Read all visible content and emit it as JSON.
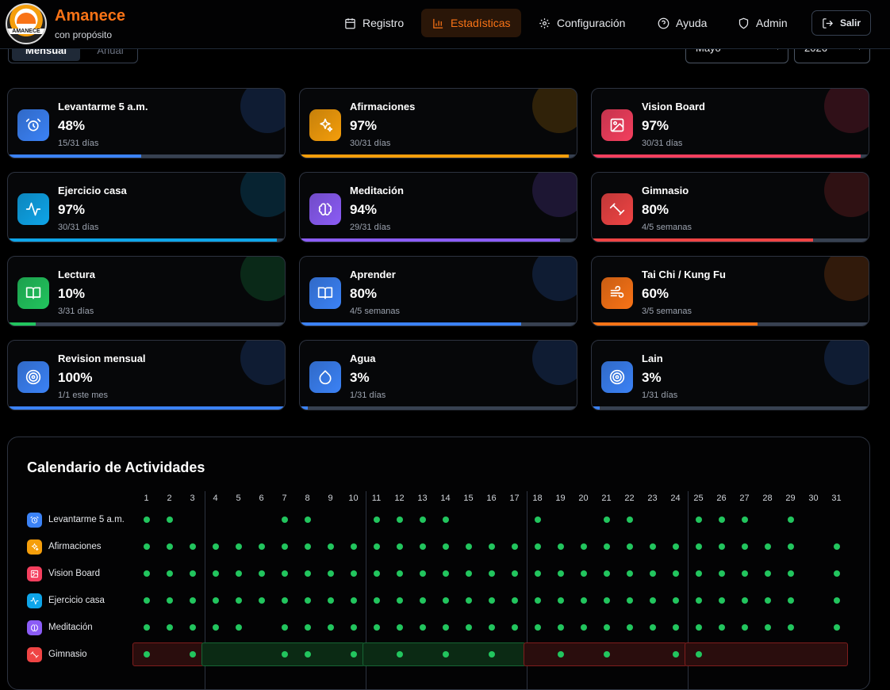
{
  "header": {
    "brand": "Amanece",
    "tagline": "con propósito",
    "logo_text": "AMANECE",
    "nav": [
      {
        "label": "Registro",
        "icon": "calendar-icon"
      },
      {
        "label": "Estadísticas",
        "icon": "bar-chart-icon",
        "active": true
      },
      {
        "label": "Configuración",
        "icon": "gear-icon"
      },
      {
        "label": "Ayuda",
        "icon": "help-icon"
      },
      {
        "label": "Admin",
        "icon": "shield-icon"
      },
      {
        "label": "Salir",
        "icon": "logout-icon"
      }
    ]
  },
  "filters": {
    "period_options": [
      "Mensual",
      "Anual"
    ],
    "selected_period": "Mensual",
    "month": "Mayo",
    "year": "2026"
  },
  "colors": {
    "accent": "#f97316",
    "done": "#22c55e"
  },
  "cards": [
    {
      "name": "Levantarme 5 a.m.",
      "percent": "48%",
      "sub": "15/31 días",
      "progress": 0.48,
      "color": "#3b82f6",
      "icon": "alarm-clock-icon"
    },
    {
      "name": "Afirmaciones",
      "percent": "97%",
      "sub": "30/31 días",
      "progress": 0.97,
      "color": "#f59e0b",
      "icon": "sparkles-icon"
    },
    {
      "name": "Vision Board",
      "percent": "97%",
      "sub": "30/31 días",
      "progress": 0.97,
      "color": "#f43f5e",
      "icon": "image-icon"
    },
    {
      "name": "Ejercicio casa",
      "percent": "97%",
      "sub": "30/31 días",
      "progress": 0.97,
      "color": "#0ea5e9",
      "icon": "activity-icon"
    },
    {
      "name": "Meditación",
      "percent": "94%",
      "sub": "29/31 días",
      "progress": 0.94,
      "color": "#8b5cf6",
      "icon": "brain-icon"
    },
    {
      "name": "Gimnasio",
      "percent": "80%",
      "sub": "4/5 semanas",
      "progress": 0.8,
      "color": "#ef4444",
      "icon": "dumbbell-icon"
    },
    {
      "name": "Lectura",
      "percent": "10%",
      "sub": "3/31 días",
      "progress": 0.1,
      "color": "#22c55e",
      "icon": "book-icon"
    },
    {
      "name": "Aprender",
      "percent": "80%",
      "sub": "4/5 semanas",
      "progress": 0.8,
      "color": "#3b82f6",
      "icon": "book-open-icon"
    },
    {
      "name": "Tai Chi / Kung Fu",
      "percent": "60%",
      "sub": "3/5 semanas",
      "progress": 0.6,
      "color": "#f97316",
      "icon": "wind-icon"
    },
    {
      "name": "Revision mensual",
      "percent": "100%",
      "sub": "1/1 este mes",
      "progress": 1.0,
      "color": "#3b82f6",
      "icon": "target-icon"
    },
    {
      "name": "Agua",
      "percent": "3%",
      "sub": "1/31 días",
      "progress": 0.03,
      "color": "#3b82f6",
      "icon": "droplet-icon"
    },
    {
      "name": "Lain",
      "percent": "3%",
      "sub": "1/31 días",
      "progress": 0.03,
      "color": "#3b82f6",
      "icon": "target-icon"
    }
  ],
  "calendar": {
    "title": "Calendario de Actividades",
    "days": [
      1,
      2,
      3,
      4,
      5,
      6,
      7,
      8,
      9,
      10,
      11,
      12,
      13,
      14,
      15,
      16,
      17,
      18,
      19,
      20,
      21,
      22,
      23,
      24,
      25,
      26,
      27,
      28,
      29,
      30,
      31
    ],
    "week_ends": [
      3,
      10,
      17,
      24
    ],
    "rows": [
      {
        "name": "Levantarme 5 a.m.",
        "color": "#3b82f6",
        "icon": "alarm-clock-icon",
        "done": [
          1,
          2,
          7,
          8,
          11,
          12,
          13,
          14,
          18,
          21,
          22,
          25,
          26,
          27,
          29
        ]
      },
      {
        "name": "Afirmaciones",
        "color": "#f59e0b",
        "icon": "sparkles-icon",
        "done": [
          1,
          2,
          3,
          4,
          5,
          6,
          7,
          8,
          9,
          10,
          11,
          12,
          13,
          14,
          15,
          16,
          17,
          18,
          19,
          20,
          21,
          22,
          23,
          24,
          25,
          26,
          27,
          28,
          29,
          31
        ]
      },
      {
        "name": "Vision Board",
        "color": "#f43f5e",
        "icon": "image-icon",
        "done": [
          1,
          2,
          3,
          4,
          5,
          6,
          7,
          8,
          9,
          10,
          11,
          12,
          13,
          14,
          15,
          16,
          17,
          18,
          19,
          20,
          21,
          22,
          23,
          24,
          25,
          26,
          27,
          28,
          29,
          31
        ]
      },
      {
        "name": "Ejercicio casa",
        "color": "#0ea5e9",
        "icon": "activity-icon",
        "done": [
          1,
          2,
          3,
          4,
          5,
          6,
          7,
          8,
          9,
          10,
          11,
          12,
          13,
          14,
          15,
          16,
          17,
          18,
          19,
          20,
          21,
          22,
          23,
          24,
          25,
          26,
          27,
          28,
          29,
          31
        ]
      },
      {
        "name": "Meditación",
        "color": "#8b5cf6",
        "icon": "brain-icon",
        "done": [
          1,
          2,
          3,
          4,
          5,
          7,
          8,
          9,
          10,
          11,
          12,
          13,
          14,
          15,
          16,
          17,
          18,
          19,
          20,
          21,
          22,
          23,
          24,
          25,
          26,
          27,
          28,
          29,
          31
        ]
      },
      {
        "name": "Gimnasio",
        "color": "#ef4444",
        "icon": "dumbbell-icon",
        "done": [
          1,
          3,
          7,
          8,
          10,
          12,
          14,
          16,
          19,
          21,
          24,
          25
        ],
        "weeks": [
          {
            "from": 1,
            "to": 3,
            "met": false
          },
          {
            "from": 4,
            "to": 10,
            "met": true
          },
          {
            "from": 11,
            "to": 17,
            "met": true
          },
          {
            "from": 18,
            "to": 24,
            "met": false
          },
          {
            "from": 25,
            "to": 31,
            "met": false
          }
        ]
      }
    ]
  }
}
